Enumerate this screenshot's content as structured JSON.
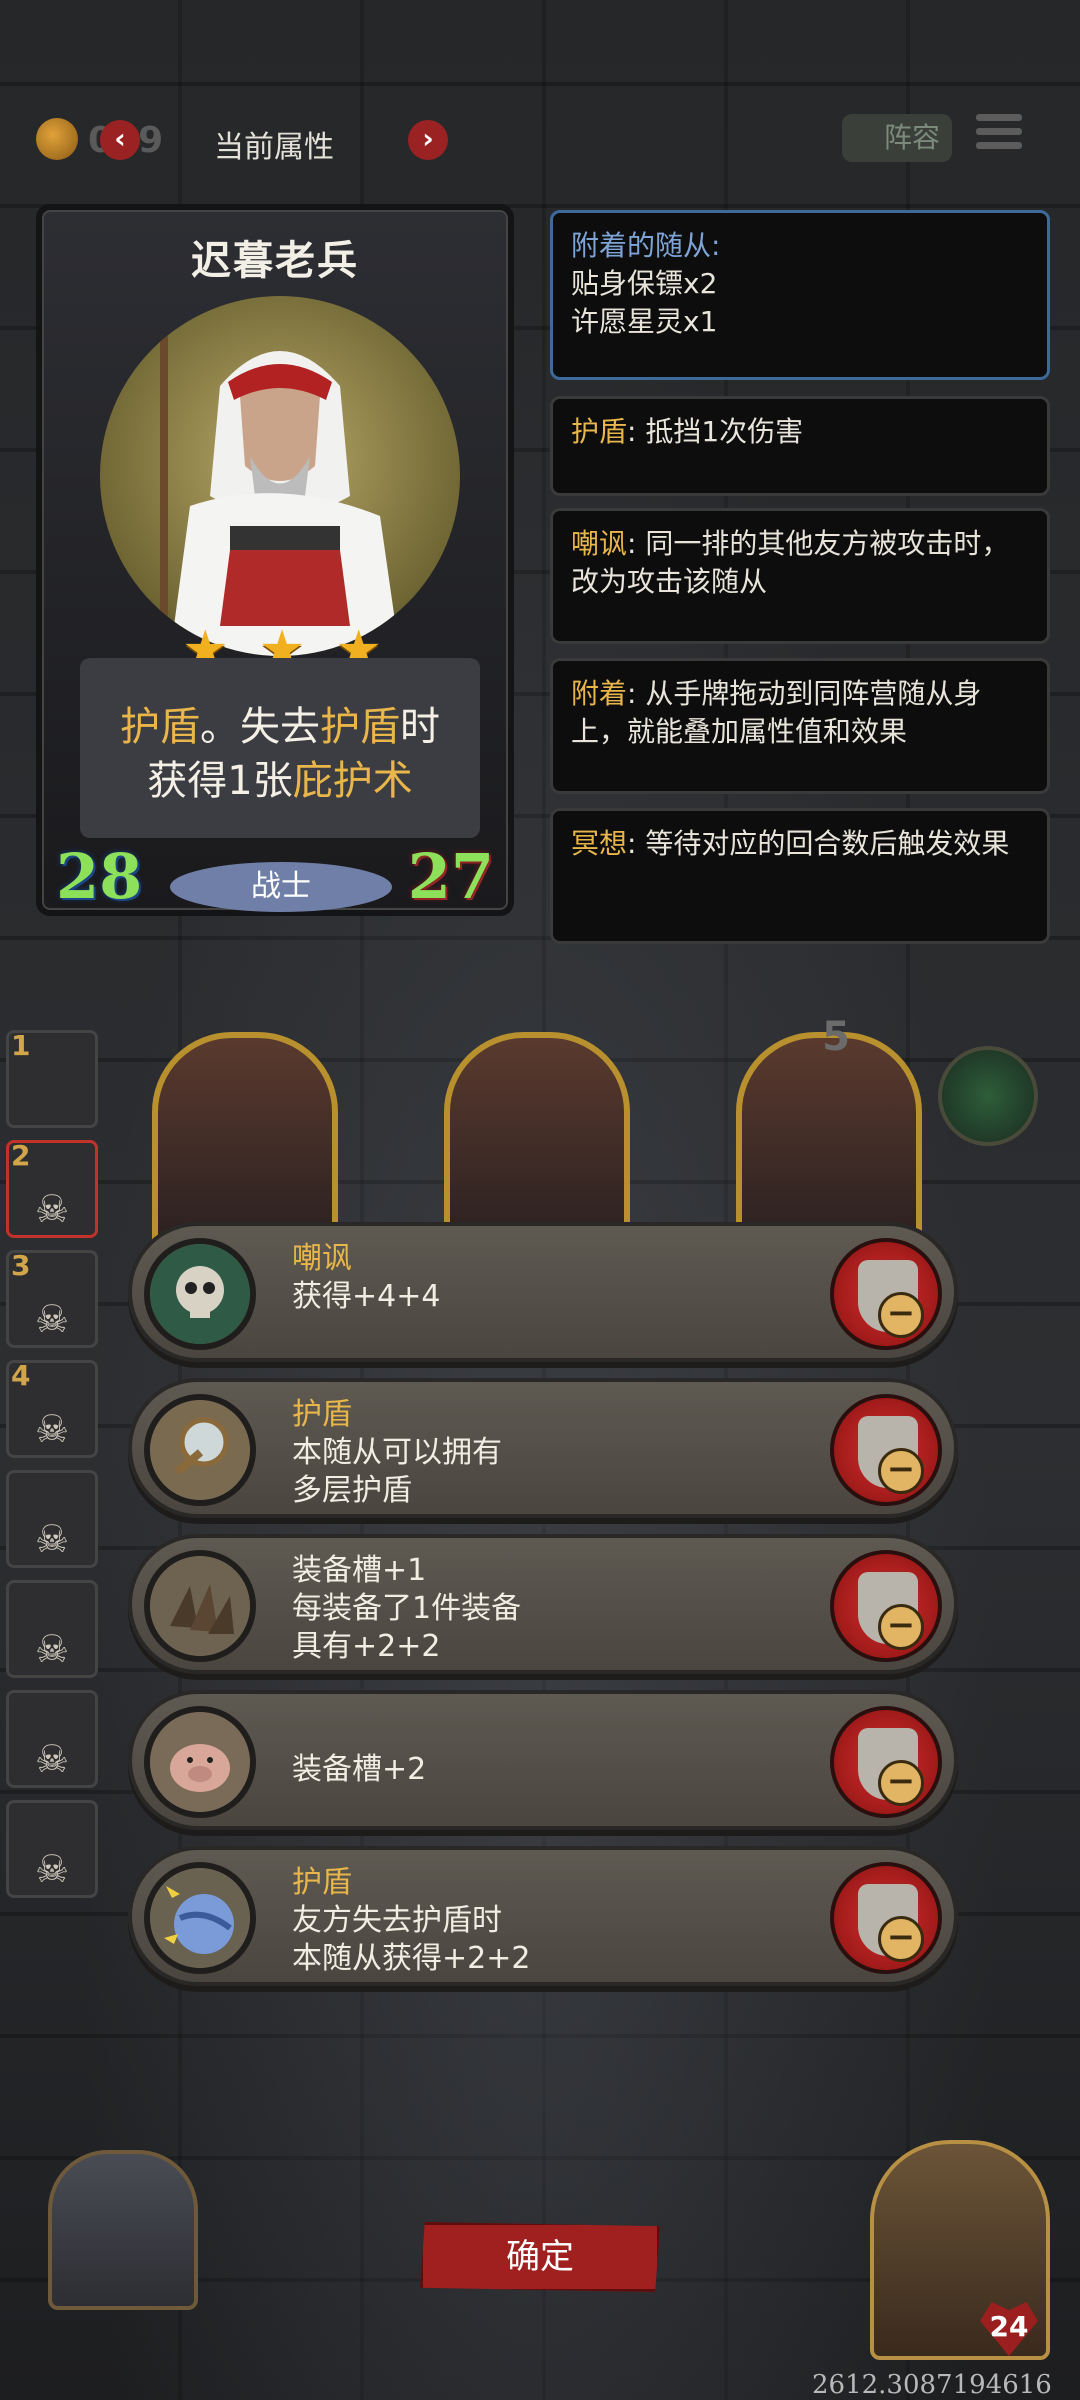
{
  "topbar": {
    "coin_count": "019",
    "prev_symbol": "‹",
    "next_symbol": "›",
    "title": "当前属性",
    "lineup_label": "阵容"
  },
  "card": {
    "name": "迟暮老兵",
    "stars": 3,
    "description": {
      "line1_kw1": "护盾",
      "line1_mid": "。失去",
      "line1_kw2": "护盾",
      "line1_end": "时",
      "line2_pre": "获得1张",
      "line2_kw": "庇护术"
    },
    "attack": "28",
    "class": "战士",
    "health": "27"
  },
  "attached_panel": {
    "heading": "附着的随从:",
    "items": [
      "贴身保镖x2",
      "许愿星灵x1"
    ]
  },
  "keyword_panels": [
    {
      "keyword": "护盾",
      "text": ": 抵挡1次伤害"
    },
    {
      "keyword": "嘲讽",
      "text": ": 同一排的其他友方被攻击时，改为攻击该随从"
    },
    {
      "keyword": "附着",
      "text": ": 从手牌拖动到同阵营随从身上，就能叠加属性值和效果"
    },
    {
      "keyword": "冥想",
      "text": ": 等待对应的回合数后触发效果"
    }
  ],
  "slots": {
    "level_badge": "5"
  },
  "roster": [
    {
      "num": "1"
    },
    {
      "num": "2"
    },
    {
      "num": "3"
    },
    {
      "num": "4"
    },
    {
      "num": ""
    },
    {
      "num": ""
    },
    {
      "num": ""
    },
    {
      "num": ""
    }
  ],
  "effects": [
    {
      "icon": "skull-icon",
      "title": "嘲讽",
      "lines": [
        "获得+4+4"
      ]
    },
    {
      "icon": "mirror-icon",
      "title": "护盾",
      "lines": [
        "本随从可以拥有",
        "多层护盾"
      ]
    },
    {
      "icon": "spikes-icon",
      "title": "装备槽+1",
      "lines": [
        "每装备了1件装备",
        "具有+2+2"
      ]
    },
    {
      "icon": "pig-icon",
      "title": "",
      "lines": [
        "装备槽+2"
      ]
    },
    {
      "icon": "globe-icon",
      "title": "护盾",
      "lines": [
        "友方失去护盾时",
        "本随从获得+2+2"
      ]
    }
  ],
  "confirm_label": "确定",
  "hero_health": "24",
  "coords_text": "2612.3087194616",
  "colors": {
    "keyword": "#e8b64a",
    "panel_head": "#7ea4d6",
    "confirm": "#a01f1f"
  }
}
